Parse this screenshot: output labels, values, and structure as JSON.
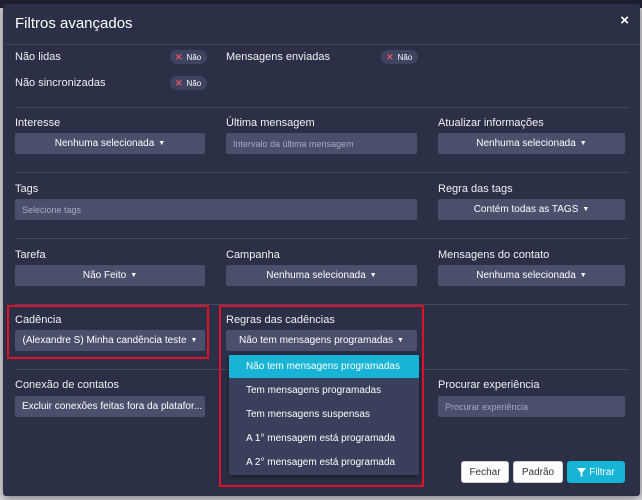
{
  "modal": {
    "title": "Filtros avançados",
    "close_glyph": "×"
  },
  "toggles": [
    {
      "label": "Não lidas",
      "value": "Não"
    },
    {
      "label": "Mensagens enviadas",
      "value": "Não"
    },
    {
      "label": "Não sincronizadas",
      "value": "Não"
    }
  ],
  "row1": {
    "interesse": {
      "label": "Interesse",
      "value": "Nenhuma selecionada"
    },
    "ultima": {
      "label": "Última mensagem",
      "placeholder": "Intervalo da última mensagem"
    },
    "atualizar": {
      "label": "Atualizar informações",
      "value": "Nenhuma selecionada"
    }
  },
  "row2": {
    "tags": {
      "label": "Tags",
      "placeholder": "Selecione tags"
    },
    "regra_tags": {
      "label": "Regra das tags",
      "value": "Contém todas as TAGS"
    }
  },
  "row3": {
    "tarefa": {
      "label": "Tarefa",
      "value": "Não Feito"
    },
    "campanha": {
      "label": "Campanha",
      "value": "Nenhuma selecionada"
    },
    "mensagens_contato": {
      "label": "Mensagens do contato",
      "value": "Nenhuma selecionada"
    }
  },
  "row4": {
    "cadencia": {
      "label": "Cadência",
      "value": "(Alexandre S) Minha candência teste"
    },
    "regras_cadencias": {
      "label": "Regras das cadências",
      "value": "Não tem mensagens programadas",
      "options": [
        "Não tem mensagens programadas",
        "Tem mensagens programadas",
        "Tem mensagens suspensas",
        "A 1° mensagem está programada",
        "A 2° mensagem está programada"
      ]
    }
  },
  "row5": {
    "conexao": {
      "label": "Conexão de contatos",
      "value": "Excluir conexões feitas fora da platafor..."
    },
    "experiencia": {
      "label": "Procurar experiência",
      "placeholder": "Procurar experiência"
    }
  },
  "footer": {
    "fechar": "Fechar",
    "padrao": "Padrão",
    "filtrar": "Filtrar"
  },
  "colors": {
    "modal_bg": "#2c3047",
    "control_bg": "#4a4f6c",
    "accent": "#17b4d6",
    "highlight_box": "#e0102a",
    "toggle_x": "#e05567"
  }
}
